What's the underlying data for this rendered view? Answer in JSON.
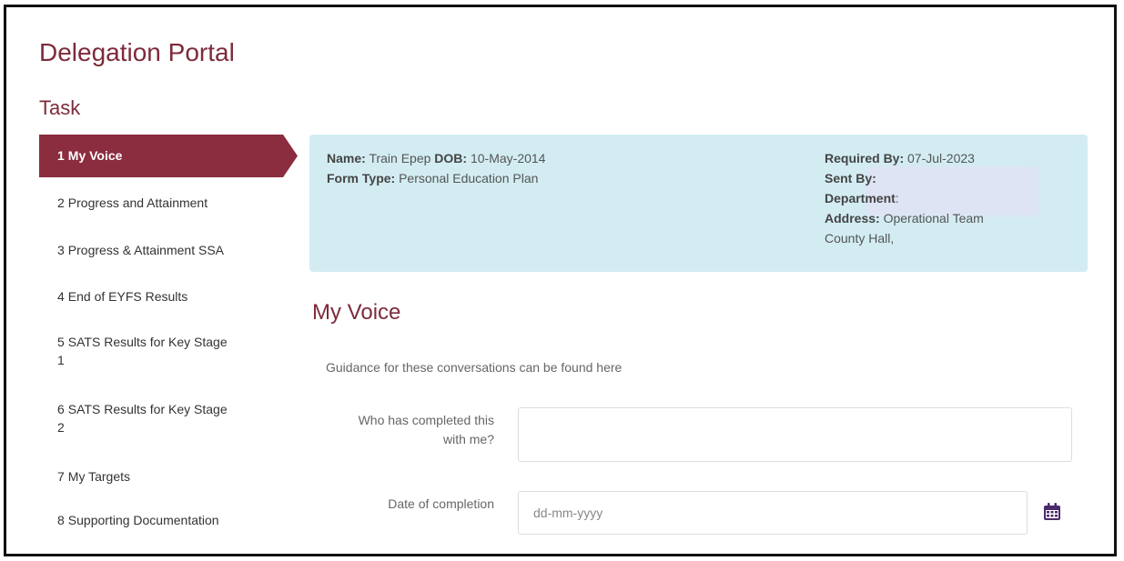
{
  "app_title": "Delegation Portal",
  "task_heading": "Task",
  "nav": {
    "items": [
      {
        "num": "1",
        "label": "My Voice",
        "active": true
      },
      {
        "num": "2",
        "label": "Progress and Attainment"
      },
      {
        "num": "3",
        "label": "Progress & Attainment SSA"
      },
      {
        "num": "4",
        "label": "End of EYFS Results"
      },
      {
        "num": "5",
        "label": "SATS Results for Key Stage",
        "label2": "1"
      },
      {
        "num": "6",
        "label": "SATS Results for Key Stage",
        "label2": "2"
      },
      {
        "num": "7",
        "label": "My Targets"
      },
      {
        "num": "8",
        "label": "Supporting Documentation"
      }
    ]
  },
  "info": {
    "name_label": "Name:",
    "name_value": "Train Epep",
    "dob_label": "DOB:",
    "dob_value": "10-May-2014",
    "form_type_label": "Form Type:",
    "form_type_value": "Personal Education Plan",
    "required_by_label": "Required By:",
    "required_by_value": "07-Jul-2023",
    "sent_by_label": "Sent By:",
    "department_label": "Department",
    "department_colon": ":",
    "address_label": "Address:",
    "address_value": "Operational Team",
    "address_line2": "County Hall,"
  },
  "section": {
    "title": "My Voice",
    "guidance": "Guidance for these conversations can be found here"
  },
  "form": {
    "completed_by_label_line1": "Who has completed this",
    "completed_by_label_line2": "with me?",
    "completed_by_value": "",
    "date_label": "Date of completion",
    "date_placeholder": "dd-mm-yyyy"
  },
  "colors": {
    "accent": "#8b2d3f",
    "title": "#7d2b3a",
    "info_bg": "#d2ecf2",
    "calendar_icon": "#4b2a6b"
  }
}
